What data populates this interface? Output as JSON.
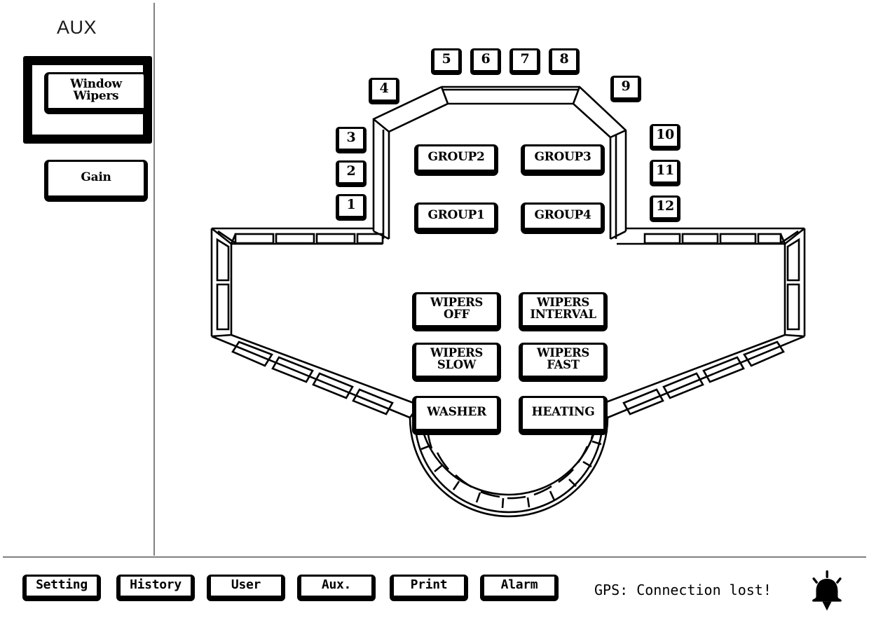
{
  "sidebar": {
    "title": "AUX",
    "items": [
      {
        "label": "Window\nWipers",
        "selected": true,
        "name": "window-wipers"
      },
      {
        "label": "Gain",
        "selected": false,
        "name": "gain"
      }
    ]
  },
  "bridge": {
    "numbered_buttons_left": [
      "3",
      "2",
      "1"
    ],
    "numbered_button_upper_left": "4",
    "numbered_buttons_top": [
      "5",
      "6",
      "7",
      "8"
    ],
    "numbered_button_upper_right": "9",
    "numbered_buttons_right": [
      "10",
      "11",
      "12"
    ],
    "group_buttons": [
      {
        "label": "GROUP2"
      },
      {
        "label": "GROUP3"
      },
      {
        "label": "GROUP1"
      },
      {
        "label": "GROUP4"
      }
    ],
    "wiper_buttons": [
      {
        "label": "WIPERS\nOFF"
      },
      {
        "label": "WIPERS\nINTERVAL"
      },
      {
        "label": "WIPERS\nSLOW"
      },
      {
        "label": "WIPERS\nFAST"
      },
      {
        "label": "WASHER"
      },
      {
        "label": "HEATING"
      }
    ]
  },
  "toolbar": {
    "buttons": [
      {
        "label": "Setting",
        "name": "setting"
      },
      {
        "label": "History",
        "name": "history"
      },
      {
        "label": "User",
        "name": "user"
      },
      {
        "label": "Aux.",
        "name": "aux"
      },
      {
        "label": "Print",
        "name": "print"
      },
      {
        "label": "Alarm",
        "name": "alarm"
      }
    ],
    "status": "GPS: Connection lost!",
    "alarm_icon": "bell-icon"
  },
  "colors": {
    "background": "#ffffff",
    "foreground": "#000000",
    "divider": "#808080"
  }
}
